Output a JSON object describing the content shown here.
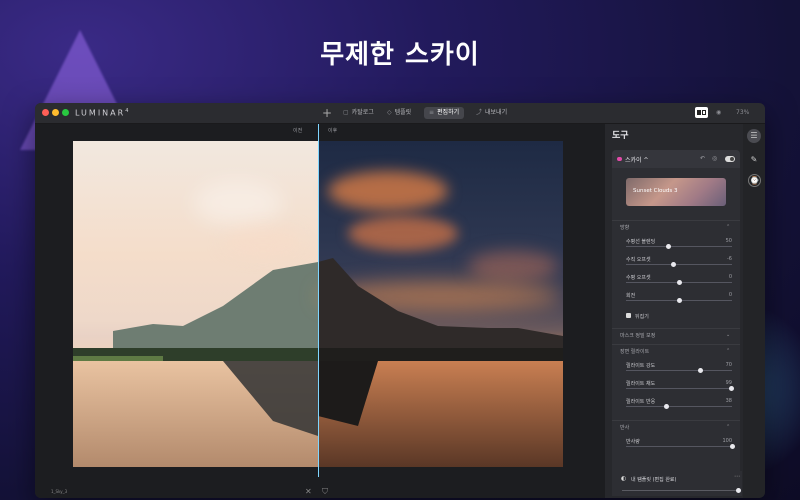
{
  "headline": "무제한 스카이",
  "app": {
    "logo": "LUMINAR",
    "logo_suffix": "4",
    "tabs": [
      {
        "icon": "folder-icon",
        "label": "카탈로그"
      },
      {
        "icon": "template-icon",
        "label": "템플릿"
      },
      {
        "icon": "sliders-icon",
        "label": "편집하기"
      },
      {
        "icon": "export-icon",
        "label": "내보내기"
      }
    ],
    "zoom": "73%",
    "compare": {
      "before": "이전",
      "after": "이후"
    },
    "canvas_foot": "1_Sky_3"
  },
  "panel": {
    "title": "도구",
    "card_title": "스카이 ^",
    "sky_preset": "Sunset Clouds 3",
    "sections": {
      "orientation": "방향",
      "mask": "마스크 정밀 보정",
      "relight": "장면 릴라이트",
      "reflection": "반사"
    },
    "sliders": [
      {
        "label": "수평선 블렌딩",
        "value": "50",
        "pct": 0.5
      },
      {
        "label": "수직 오프셋",
        "value": "-6",
        "pct": 0.44
      },
      {
        "label": "수평 오프셋",
        "value": "0",
        "pct": 0.5
      },
      {
        "label": "회전",
        "value": "0",
        "pct": 0.5
      }
    ],
    "flip_label": "뒤집기",
    "relight_sliders": [
      {
        "label": "릴라이트 강도",
        "value": "70",
        "pct": 0.7
      },
      {
        "label": "릴라이트 채도",
        "value": "99",
        "pct": 0.99
      },
      {
        "label": "릴라이트 반응",
        "value": "38",
        "pct": 0.38
      }
    ],
    "reflection_slider": {
      "label": "반사량",
      "value": "100",
      "pct": 1.0
    },
    "template_label": "내 템플릿 (편집 완료)"
  }
}
